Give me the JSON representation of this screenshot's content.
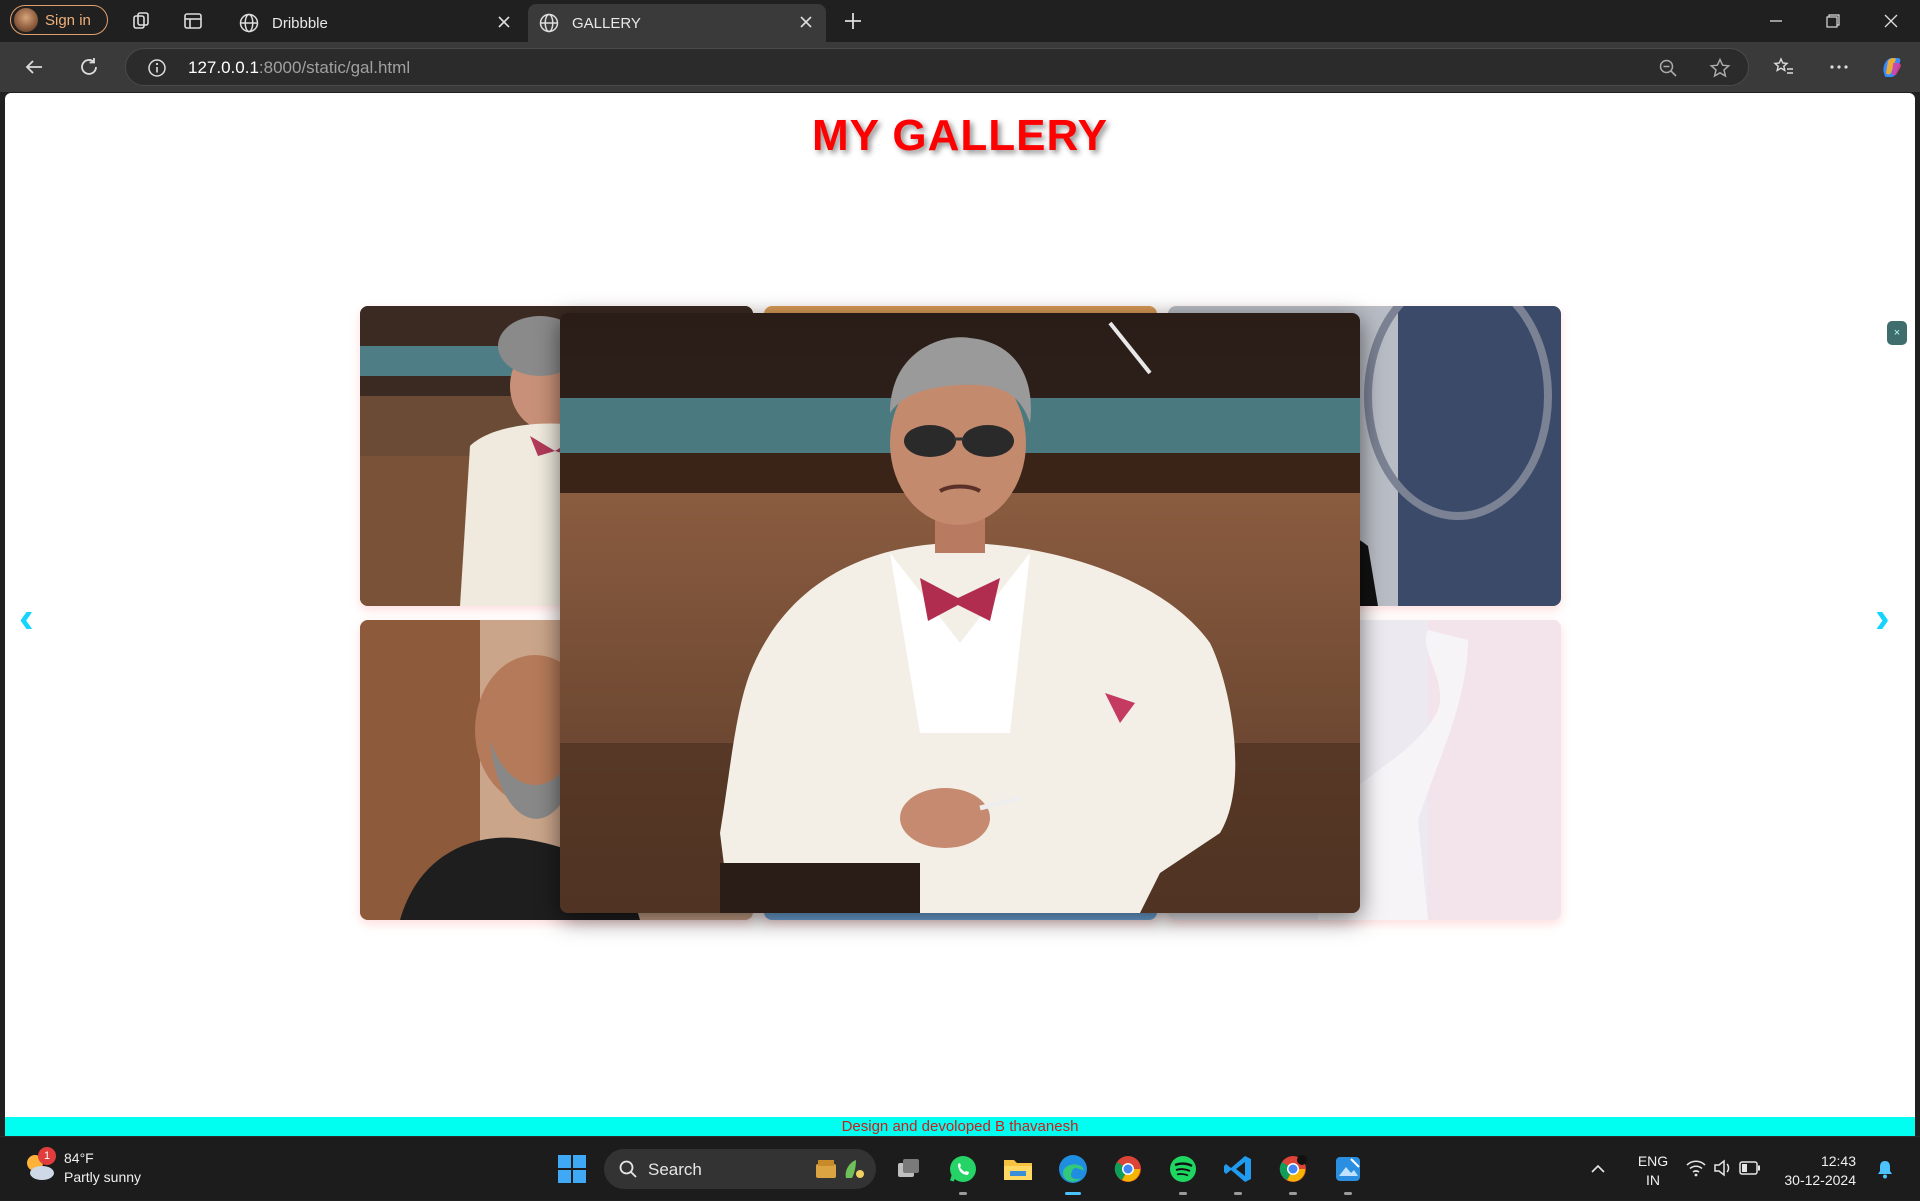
{
  "browser": {
    "signin_label": "Sign in",
    "tabs": [
      {
        "title": "Dribbble",
        "active": false
      },
      {
        "title": "GALLERY",
        "active": true
      }
    ],
    "url_host": "127.0.0.1",
    "url_rest": ":8000/static/gal.html"
  },
  "page": {
    "title": "MY GALLERY",
    "prev_arrow": "‹",
    "next_arrow": "›",
    "close_chip": "×",
    "footer": "Design and devoloped B thavanesh"
  },
  "taskbar": {
    "weather_temp": "84°F",
    "weather_desc": "Partly sunny",
    "weather_badge": "1",
    "search_label": "Search",
    "lang_top": "ENG",
    "lang_bottom": "IN",
    "time": "12:43",
    "date": "30-12-2024"
  },
  "colors": {
    "title_red": "#ff0000",
    "footer_cyan": "#00fff0",
    "arrow_cyan": "#15d4ff"
  }
}
